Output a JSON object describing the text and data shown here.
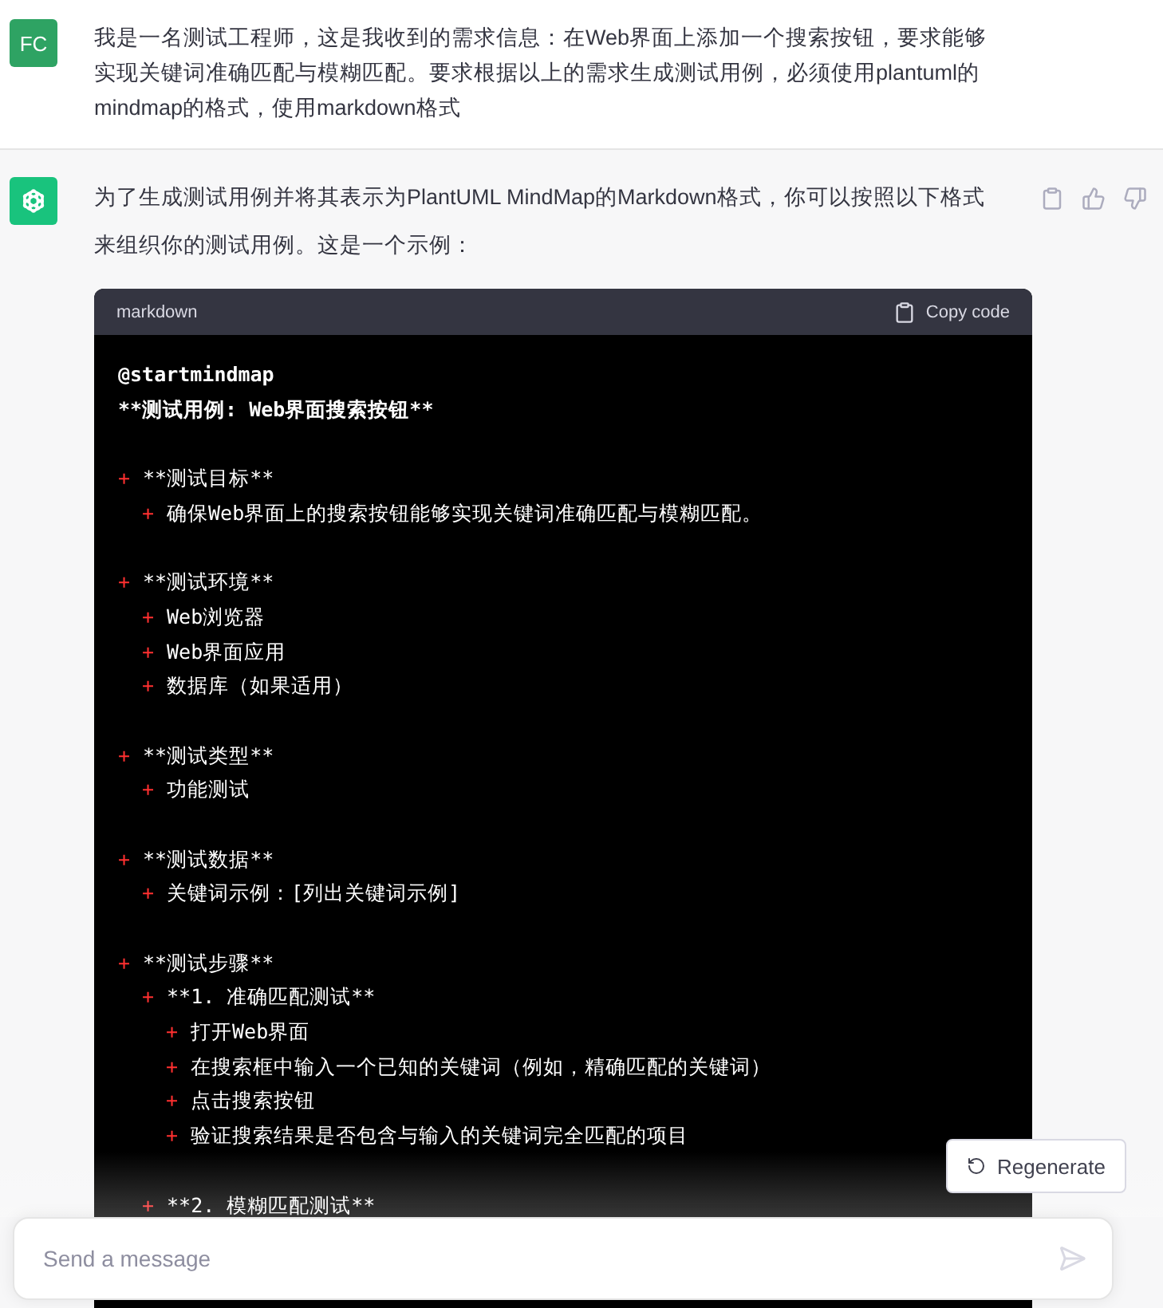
{
  "user_message": {
    "avatar": "FC",
    "text": "我是一名测试工程师，这是我收到的需求信息：在Web界面上添加一个搜索按钮，要求能够实现关键词准确匹配与模糊匹配。要求根据以上的需求生成测试用例，必须使用plantuml的mindmap的格式，使用markdown格式"
  },
  "assistant_message": {
    "text": "为了生成测试用例并将其表示为PlantUML MindMap的Markdown格式，你可以按照以下格式来组织你的测试用例。这是一个示例：",
    "code_block": {
      "language": "markdown",
      "copy_label": "Copy code",
      "header_lines": [
        "@startmindmap",
        "**测试用例: Web界面搜索按钮**"
      ],
      "sections": [
        {
          "marker": "+",
          "text": "**测试目标**",
          "children": [
            {
              "marker": "+",
              "text": "确保Web界面上的搜索按钮能够实现关键词准确匹配与模糊匹配。"
            }
          ]
        },
        {
          "marker": "+",
          "text": "**测试环境**",
          "children": [
            {
              "marker": "+",
              "text": "Web浏览器"
            },
            {
              "marker": "+",
              "text": "Web界面应用"
            },
            {
              "marker": "+",
              "text": "数据库（如果适用）"
            }
          ]
        },
        {
          "marker": "+",
          "text": "**测试类型**",
          "children": [
            {
              "marker": "+",
              "text": "功能测试"
            }
          ]
        },
        {
          "marker": "+",
          "text": "**测试数据**",
          "children": [
            {
              "marker": "+",
              "text": "关键词示例：[列出关键词示例]"
            }
          ]
        },
        {
          "marker": "+",
          "text": "**测试步骤**",
          "children": [
            {
              "marker": "+",
              "text": "**1. 准确匹配测试**",
              "children": [
                {
                  "marker": "+",
                  "text": "打开Web界面"
                },
                {
                  "marker": "+",
                  "text": "在搜索框中输入一个已知的关键词（例如，精确匹配的关键词）"
                },
                {
                  "marker": "+",
                  "text": "点击搜索按钮"
                },
                {
                  "marker": "+",
                  "text": "验证搜索结果是否包含与输入的关键词完全匹配的项目"
                }
              ]
            },
            {
              "marker": "+",
              "text": "**2. 模糊匹配测试**"
            }
          ]
        }
      ]
    }
  },
  "regenerate_button": {
    "label": "Regenerate"
  },
  "composer": {
    "placeholder": "Send a message"
  }
}
